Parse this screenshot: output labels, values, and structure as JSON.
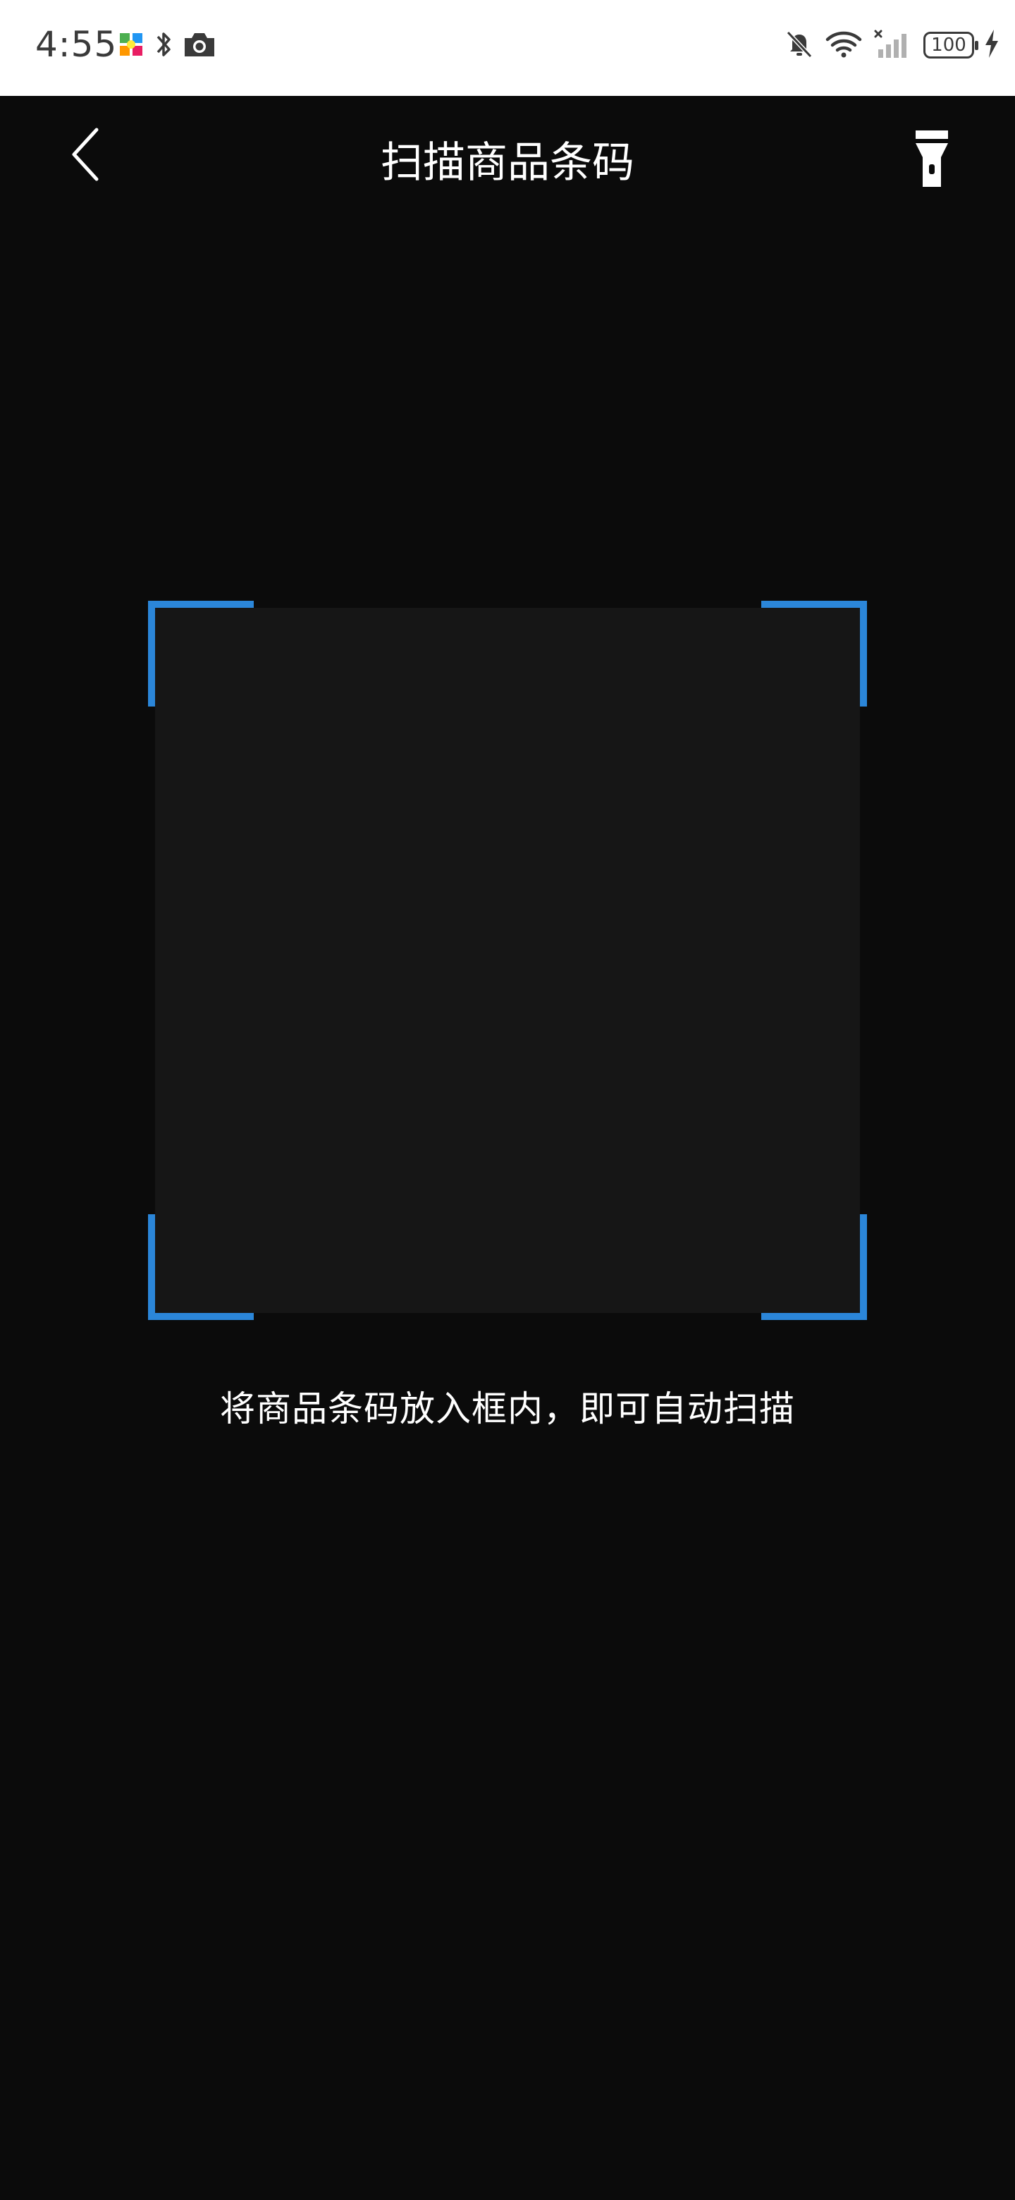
{
  "status_bar": {
    "time": "4:55",
    "battery_level": "100",
    "icons": [
      "app-notification-icon",
      "bluetooth-icon",
      "camera-icon",
      "mute-icon",
      "wifi-icon",
      "signal-icon",
      "battery-icon",
      "charging-icon"
    ]
  },
  "app_bar": {
    "title": "扫描商品条码",
    "back_icon": "chevron-left-icon",
    "flashlight_icon": "flashlight-icon"
  },
  "scanner": {
    "hint": "将商品条码放入框内，即可自动扫描",
    "frame_color": "#2b86d9"
  },
  "colors": {
    "background": "#0b0b0b",
    "status_bar": "#ffffff",
    "accent": "#2b86d9"
  }
}
